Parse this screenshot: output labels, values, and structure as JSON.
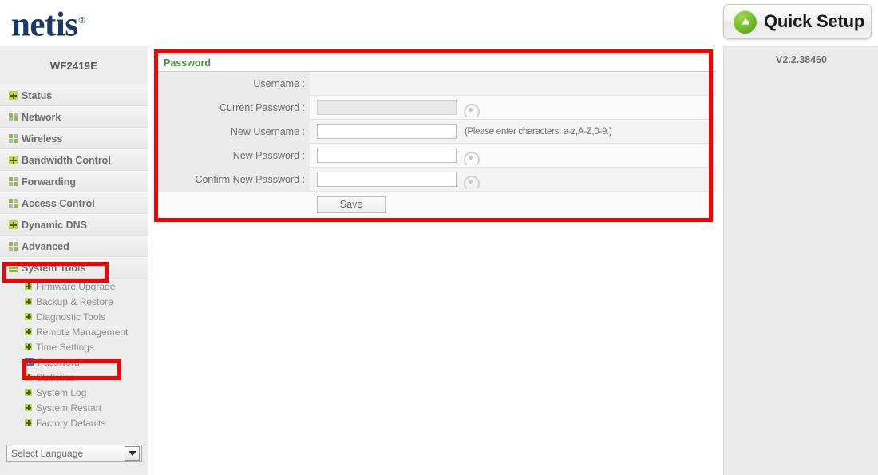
{
  "header": {
    "logo_text": "netis",
    "logo_trademark": "®",
    "quick_setup_label": "Quick Setup",
    "quick_setup_icon": "green-circle-arrow-icon"
  },
  "sidebar": {
    "device_model": "WF2419E",
    "items": [
      {
        "label": "Status",
        "icon": "star-icon"
      },
      {
        "label": "Network",
        "icon": "grid-icon"
      },
      {
        "label": "Wireless",
        "icon": "grid-icon"
      },
      {
        "label": "Bandwidth Control",
        "icon": "star-icon"
      },
      {
        "label": "Forwarding",
        "icon": "grid-icon"
      },
      {
        "label": "Access Control",
        "icon": "grid-icon"
      },
      {
        "label": "Dynamic DNS",
        "icon": "star-icon"
      },
      {
        "label": "Advanced",
        "icon": "grid-icon"
      },
      {
        "label": "System Tools",
        "icon": "bars-icon"
      }
    ],
    "submenu": [
      {
        "label": "Firmware Upgrade",
        "icon": "star-icon",
        "active": false
      },
      {
        "label": "Backup & Restore",
        "icon": "star-icon",
        "active": false
      },
      {
        "label": "Diagnostic Tools",
        "icon": "star-icon",
        "active": false
      },
      {
        "label": "Remote Management",
        "icon": "star-icon",
        "active": false
      },
      {
        "label": "Time Settings",
        "icon": "star-icon",
        "active": false
      },
      {
        "label": "Password",
        "icon": "play-icon",
        "active": true
      },
      {
        "label": "Statistics",
        "icon": "star-icon",
        "active": false
      },
      {
        "label": "System Log",
        "icon": "star-icon",
        "active": false
      },
      {
        "label": "System Restart",
        "icon": "star-icon",
        "active": false
      },
      {
        "label": "Factory Defaults",
        "icon": "star-icon",
        "active": false
      }
    ],
    "language_select_label": "Select Language"
  },
  "main": {
    "panel_title": "Password",
    "rows": [
      {
        "label": "Username :",
        "value": "",
        "input": false,
        "eye": false,
        "hint": ""
      },
      {
        "label": "Current Password :",
        "value": "",
        "input": true,
        "disabled": true,
        "eye": true,
        "hint": ""
      },
      {
        "label": "New Username :",
        "value": "",
        "input": true,
        "disabled": false,
        "eye": false,
        "hint": "(Please enter characters: a-z,A-Z,0-9.)"
      },
      {
        "label": "New Password :",
        "value": "",
        "input": true,
        "disabled": false,
        "eye": true,
        "hint": ""
      },
      {
        "label": "Confirm New Password :",
        "value": "",
        "input": true,
        "disabled": false,
        "eye": true,
        "hint": ""
      }
    ],
    "save_label": "Save"
  },
  "right": {
    "firmware_version": "V2.2.38460"
  },
  "annotations": {
    "colors": {
      "highlight": "#f80000",
      "brand_navy": "#1b3a63",
      "accent_green": "#4a8c3f"
    },
    "boxes": [
      {
        "name": "password-form-highlight"
      },
      {
        "name": "system-tools-highlight"
      },
      {
        "name": "password-menu-highlight"
      }
    ]
  }
}
